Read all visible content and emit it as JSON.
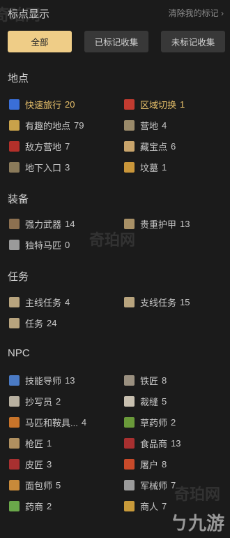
{
  "header": {
    "title": "标点显示",
    "clear_label": "清除我的标记 ›"
  },
  "filters": [
    {
      "label": "全部",
      "active": true
    },
    {
      "label": "已标记收集",
      "active": false
    },
    {
      "label": "未标记收集",
      "active": false
    }
  ],
  "sections": {
    "locations": {
      "title": "地点",
      "items": [
        {
          "label": "快速旅行",
          "count": "20",
          "icon": "fast-travel-icon",
          "color": "#3a6fd8",
          "hl": true
        },
        {
          "label": "区域切换",
          "count": "1",
          "icon": "region-switch-icon",
          "color": "#c23b30",
          "hl": true
        },
        {
          "label": "有趣的地点",
          "count": "79",
          "icon": "pin-icon",
          "color": "#c9a24a"
        },
        {
          "label": "营地",
          "count": "4",
          "icon": "camp-icon",
          "color": "#9a8a6a"
        },
        {
          "label": "敌方营地",
          "count": "7",
          "icon": "enemy-camp-icon",
          "color": "#b3302a"
        },
        {
          "label": "藏宝点",
          "count": "6",
          "icon": "treasure-map-icon",
          "color": "#c8a46b"
        },
        {
          "label": "地下入口",
          "count": "3",
          "icon": "underground-icon",
          "color": "#8a7a5a"
        },
        {
          "label": "坟墓",
          "count": "1",
          "icon": "grave-icon",
          "color": "#c9963a"
        }
      ]
    },
    "gear": {
      "title": "装备",
      "items": [
        {
          "label": "强力武器",
          "count": "14",
          "icon": "sword-icon",
          "color": "#8c7050"
        },
        {
          "label": "贵重护甲",
          "count": "13",
          "icon": "armor-icon",
          "color": "#a89066"
        },
        {
          "label": "独特马匹",
          "count": "0",
          "icon": "horse-icon",
          "color": "#9a9a9a"
        }
      ]
    },
    "quests": {
      "title": "任务",
      "items": [
        {
          "label": "主线任务",
          "count": "4",
          "icon": "main-quest-shield-icon",
          "color": "#b8a47e"
        },
        {
          "label": "支线任务",
          "count": "15",
          "icon": "side-quest-shield-icon",
          "color": "#b8a47e"
        },
        {
          "label": "任务",
          "count": "24",
          "icon": "quest-shield-icon",
          "color": "#b8a47e"
        }
      ]
    },
    "npc": {
      "title": "NPC",
      "items": [
        {
          "label": "技能导师",
          "count": "13",
          "icon": "trainer-icon",
          "color": "#4a7ac4"
        },
        {
          "label": "铁匠",
          "count": "8",
          "icon": "hammer-icon",
          "color": "#9a9080"
        },
        {
          "label": "抄写员",
          "count": "2",
          "icon": "quill-icon",
          "color": "#b8b0a0"
        },
        {
          "label": "裁缝",
          "count": "5",
          "icon": "needle-icon",
          "color": "#c8c0b0"
        },
        {
          "label": "马匹和鞍具...",
          "count": "4",
          "icon": "saddle-icon",
          "color": "#c8742a"
        },
        {
          "label": "草药师",
          "count": "2",
          "icon": "herb-icon",
          "color": "#6a9a3a"
        },
        {
          "label": "枪匠",
          "count": "1",
          "icon": "gunsmith-icon",
          "color": "#b09060"
        },
        {
          "label": "食品商",
          "count": "13",
          "icon": "food-icon",
          "color": "#a83030"
        },
        {
          "label": "皮匠",
          "count": "3",
          "icon": "leather-icon",
          "color": "#a83030"
        },
        {
          "label": "屠户",
          "count": "8",
          "icon": "butcher-icon",
          "color": "#c84a2a"
        },
        {
          "label": "面包师",
          "count": "5",
          "icon": "bread-icon",
          "color": "#c88a3a"
        },
        {
          "label": "军械师",
          "count": "7",
          "icon": "armorer-icon",
          "color": "#9a9a9a"
        },
        {
          "label": "药商",
          "count": "2",
          "icon": "potion-icon",
          "color": "#6aa84a"
        },
        {
          "label": "商人",
          "count": "7",
          "icon": "merchant-icon",
          "color": "#c89a3a"
        }
      ]
    }
  },
  "watermarks": {
    "site": "奇珀网",
    "logo": "九游"
  }
}
